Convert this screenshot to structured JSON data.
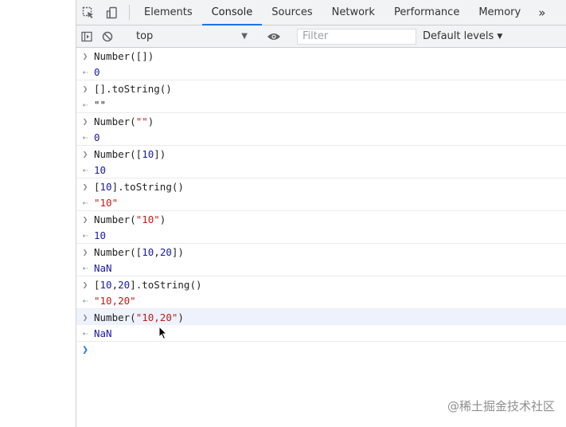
{
  "tabs": {
    "items": [
      "Elements",
      "Console",
      "Sources",
      "Network",
      "Performance",
      "Memory"
    ],
    "active": "Console",
    "more": "»"
  },
  "filterbar": {
    "context": "top",
    "filter_placeholder": "Filter",
    "levels": "Default levels"
  },
  "console": [
    {
      "in": "Number([])",
      "out": "0"
    },
    {
      "in": "[].toString()",
      "out": "\"\""
    },
    {
      "in": "Number(\"\")",
      "out": "0"
    },
    {
      "in": "Number([10])",
      "out": "10"
    },
    {
      "in": "[10].toString()",
      "out": "\"10\""
    },
    {
      "in": "Number(\"10\")",
      "out": "10"
    },
    {
      "in": "Number([10,20])",
      "out": "NaN"
    },
    {
      "in": "[10,20].toString()",
      "out": "\"10,20\""
    },
    {
      "in": "Number(\"10,20\")",
      "out": "NaN"
    }
  ],
  "watermark": "@稀土掘金技术社区",
  "colors": {
    "number": "#1a1aa6",
    "string": "#c41a16",
    "accent": "#1a73e8",
    "highlight": "#edf2fc"
  },
  "icons": {
    "inspect": "inspect-element-icon",
    "device": "device-toolbar-icon",
    "sidebar": "show-sidebar-icon",
    "clear": "clear-console-icon",
    "eye": "live-expression-eye-icon"
  }
}
